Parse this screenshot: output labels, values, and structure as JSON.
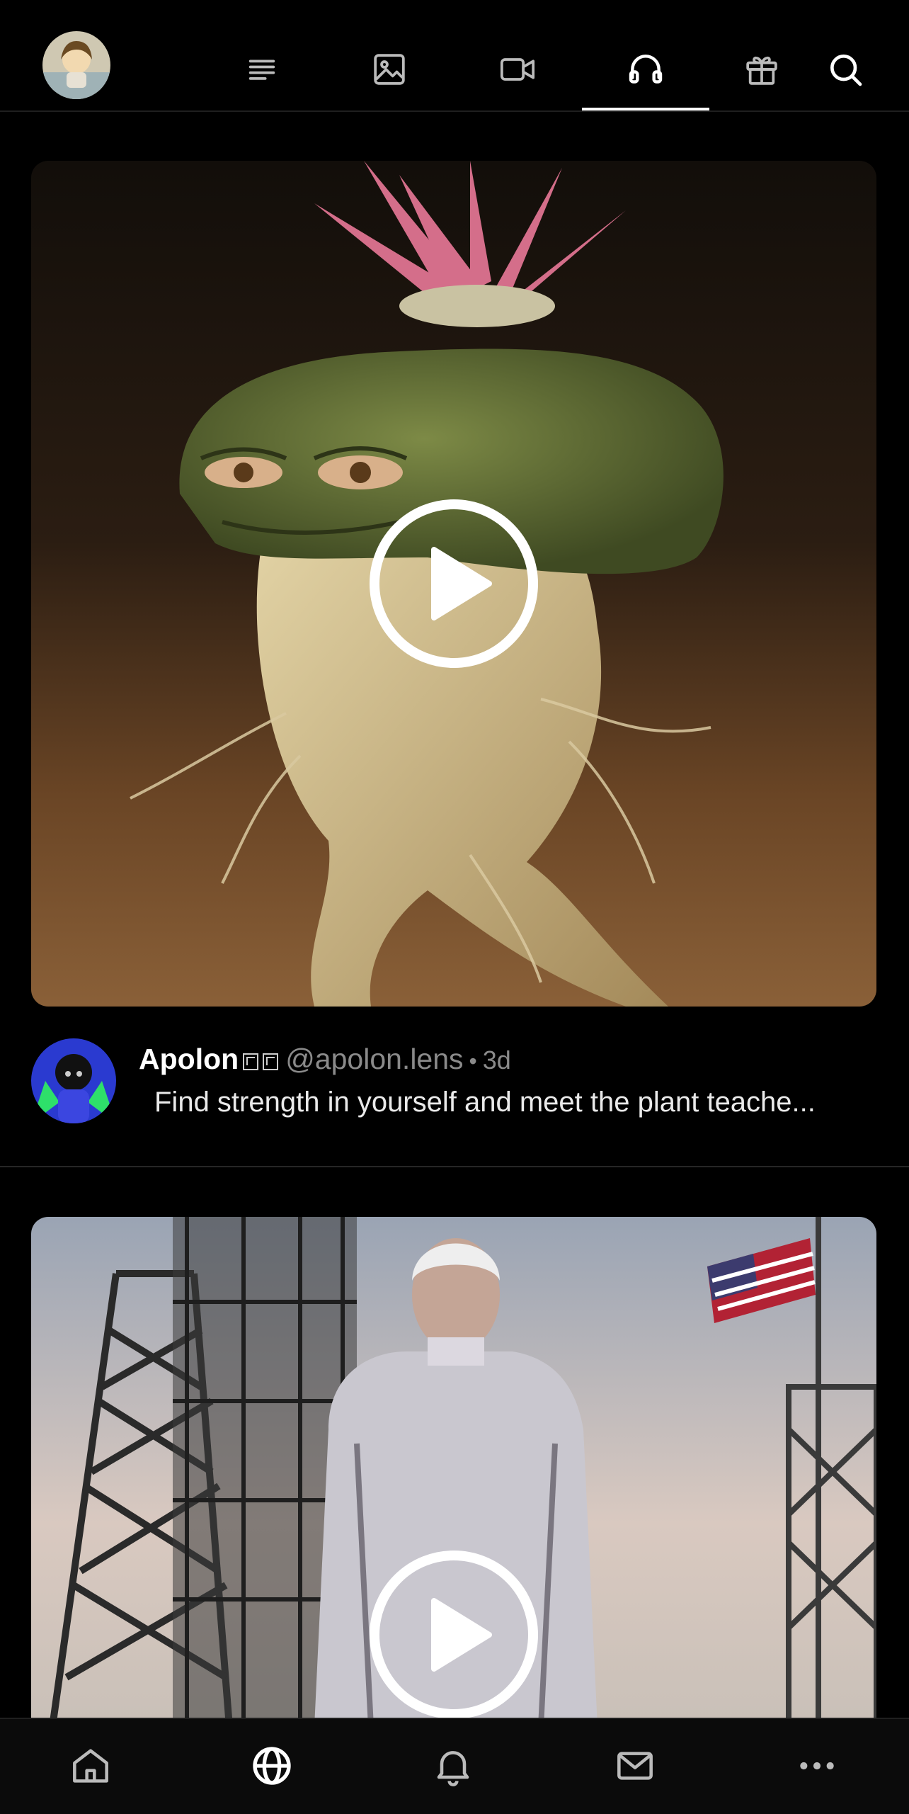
{
  "topbar": {
    "tabs": [
      {
        "icon": "feed-text-icon"
      },
      {
        "icon": "image-icon"
      },
      {
        "icon": "video-icon"
      },
      {
        "icon": "headphones-icon",
        "active": true
      },
      {
        "icon": "gift-icon"
      },
      {
        "icon": "search-icon"
      }
    ]
  },
  "posts": [
    {
      "name": "Apolon",
      "handle": "@apolon.lens",
      "separator": "•",
      "time": "3d",
      "text": "Find strength in yourself and meet the plant teache..."
    },
    {
      "name": "",
      "handle": "",
      "time": "",
      "text": ""
    }
  ],
  "bottom_nav": [
    {
      "icon": "home-icon"
    },
    {
      "icon": "globe-icon",
      "active": true
    },
    {
      "icon": "bell-icon"
    },
    {
      "icon": "mail-icon"
    },
    {
      "icon": "more-icon"
    }
  ],
  "colors": {
    "background": "#000000",
    "muted_text": "#8a8a8a",
    "divider": "#262626"
  }
}
